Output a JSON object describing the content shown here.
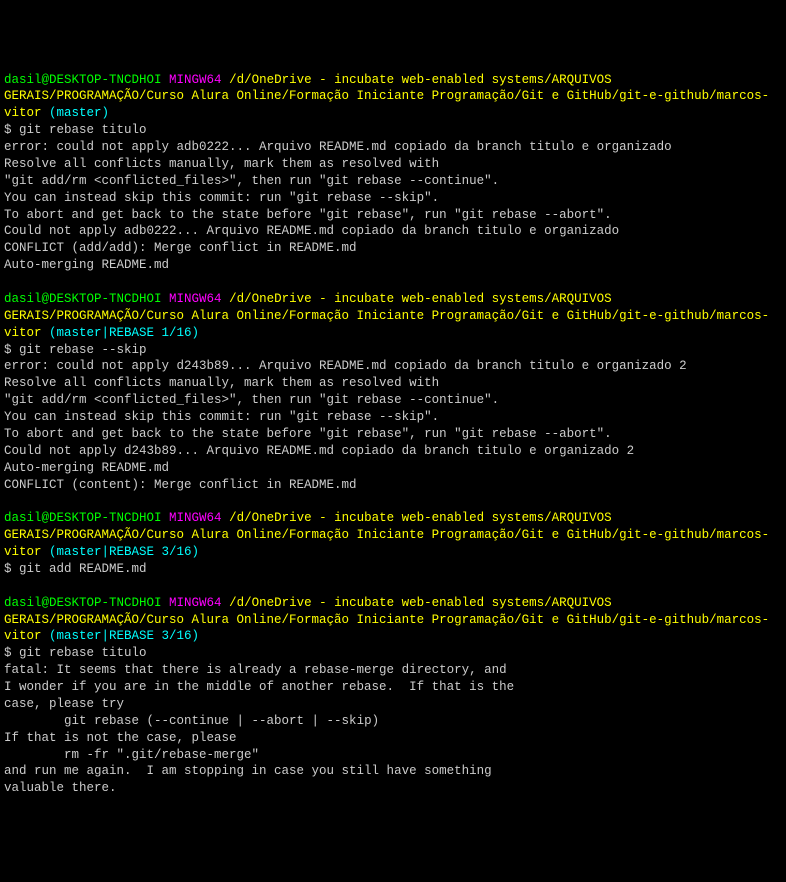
{
  "prompts": [
    {
      "user": "dasil@DESKTOP-TNCDHOI",
      "mingw": "MINGW64",
      "path": "/d/OneDrive - incubate web-enabled systems/ARQUIVOS GERAIS/PROGRAMAÇÃO/Curso Alura Online/Formação Iniciante Programação/Git e GitHub/git-e-github/marcos-vitor",
      "branch": "(master)"
    },
    {
      "user": "dasil@DESKTOP-TNCDHOI",
      "mingw": "MINGW64",
      "path": "/d/OneDrive - incubate web-enabled systems/ARQUIVOS GERAIS/PROGRAMAÇÃO/Curso Alura Online/Formação Iniciante Programação/Git e GitHub/git-e-github/marcos-vitor",
      "branch": "(master|REBASE 1/16)"
    },
    {
      "user": "dasil@DESKTOP-TNCDHOI",
      "mingw": "MINGW64",
      "path": "/d/OneDrive - incubate web-enabled systems/ARQUIVOS GERAIS/PROGRAMAÇÃO/Curso Alura Online/Formação Iniciante Programação/Git e GitHub/git-e-github/marcos-vitor",
      "branch": "(master|REBASE 3/16)"
    },
    {
      "user": "dasil@DESKTOP-TNCDHOI",
      "mingw": "MINGW64",
      "path": "/d/OneDrive - incubate web-enabled systems/ARQUIVOS GERAIS/PROGRAMAÇÃO/Curso Alura Online/Formação Iniciante Programação/Git e GitHub/git-e-github/marcos-vitor",
      "branch": "(master|REBASE 3/16)"
    }
  ],
  "commands": [
    "$ git rebase titulo",
    "$ git rebase --skip",
    "$ git add README.md",
    "$ git rebase titulo"
  ],
  "outputs": {
    "block1": [
      "error: could not apply adb0222... Arquivo README.md copiado da branch titulo e organizado",
      "Resolve all conflicts manually, mark them as resolved with",
      "\"git add/rm <conflicted_files>\", then run \"git rebase --continue\".",
      "You can instead skip this commit: run \"git rebase --skip\".",
      "To abort and get back to the state before \"git rebase\", run \"git rebase --abort\".",
      "Could not apply adb0222... Arquivo README.md copiado da branch titulo e organizado",
      "CONFLICT (add/add): Merge conflict in README.md",
      "Auto-merging README.md"
    ],
    "block2": [
      "error: could not apply d243b89... Arquivo README.md copiado da branch titulo e organizado 2",
      "Resolve all conflicts manually, mark them as resolved with",
      "\"git add/rm <conflicted_files>\", then run \"git rebase --continue\".",
      "You can instead skip this commit: run \"git rebase --skip\".",
      "To abort and get back to the state before \"git rebase\", run \"git rebase --abort\".",
      "Could not apply d243b89... Arquivo README.md copiado da branch titulo e organizado 2",
      "Auto-merging README.md",
      "CONFLICT (content): Merge conflict in README.md"
    ],
    "block4": [
      "fatal: It seems that there is already a rebase-merge directory, and",
      "I wonder if you are in the middle of another rebase.  If that is the",
      "case, please try",
      "        git rebase (--continue | --abort | --skip)",
      "If that is not the case, please",
      "        rm -fr \".git/rebase-merge\"",
      "and run me again.  I am stopping in case you still have something",
      "valuable there."
    ]
  }
}
